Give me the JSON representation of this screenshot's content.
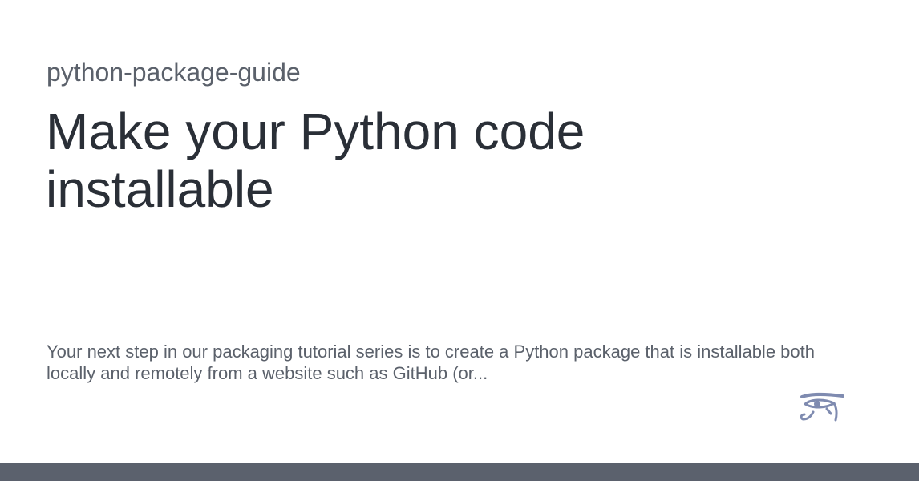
{
  "site": {
    "name": "python-package-guide"
  },
  "page": {
    "title": "Make your Python code installable",
    "description": "Your next step in our packaging tutorial series is to create a Python package that is installable both locally and remotely from a website such as GitHub (or..."
  },
  "logo": {
    "icon": "eye-of-horus-icon",
    "color": "#7f8bb0"
  },
  "footer": {
    "color": "#5b616d"
  }
}
